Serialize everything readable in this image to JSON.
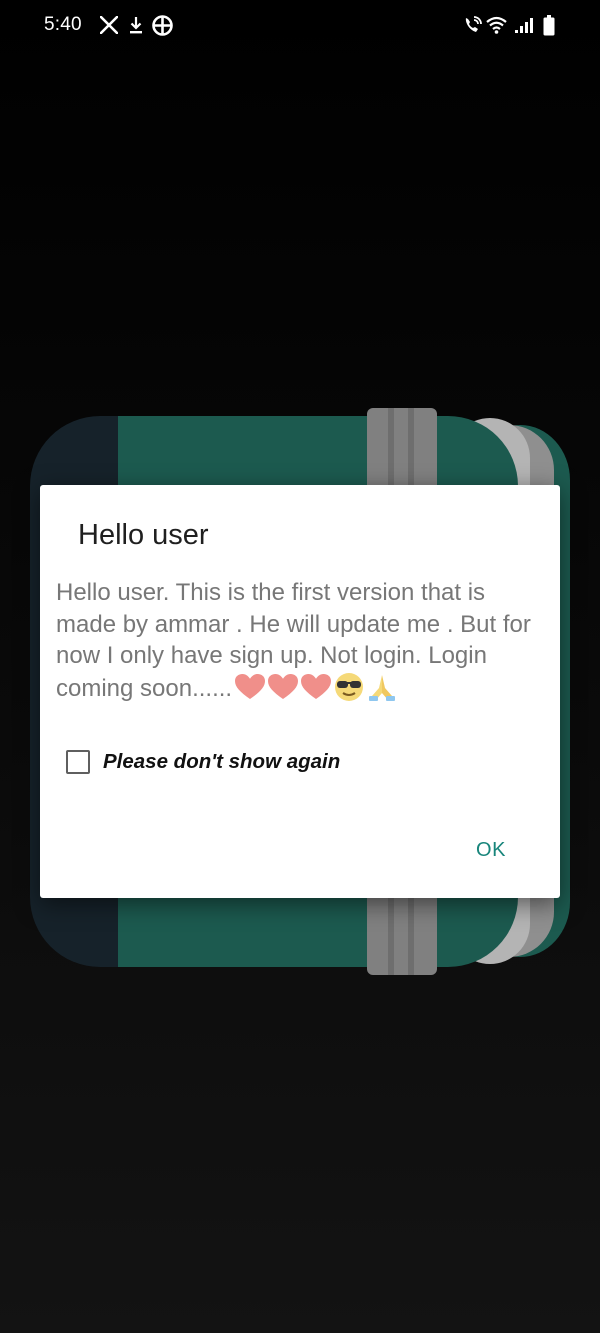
{
  "status_bar": {
    "time": "5:40",
    "left_icons": [
      "x-app-icon",
      "download-icon",
      "grid-app-icon"
    ],
    "right_icons": [
      "wifi-calling-icon",
      "wifi-icon",
      "signal-icon",
      "battery-icon"
    ]
  },
  "background": {
    "illustration": "notebook-icon",
    "colors": {
      "cover": "#1c5a4f",
      "spine": "#16222a",
      "strap": "#808080",
      "pages": "#8f8f8f"
    }
  },
  "dialog": {
    "title": "Hello user",
    "message": "Hello user. This is the first version that is made by ammar . He will update me . But for now I only have sign up. Not login. Login coming soon......",
    "message_emojis": [
      "heart-emoji",
      "heart-emoji",
      "heart-emoji",
      "sunglasses-emoji",
      "folded-hands-emoji"
    ],
    "checkbox_label": "Please don't show again",
    "checkbox_checked": false,
    "ok_label": "OK"
  },
  "colors": {
    "accent": "#18857b",
    "dialog_bg": "#ffffff",
    "message_text": "#777777"
  }
}
